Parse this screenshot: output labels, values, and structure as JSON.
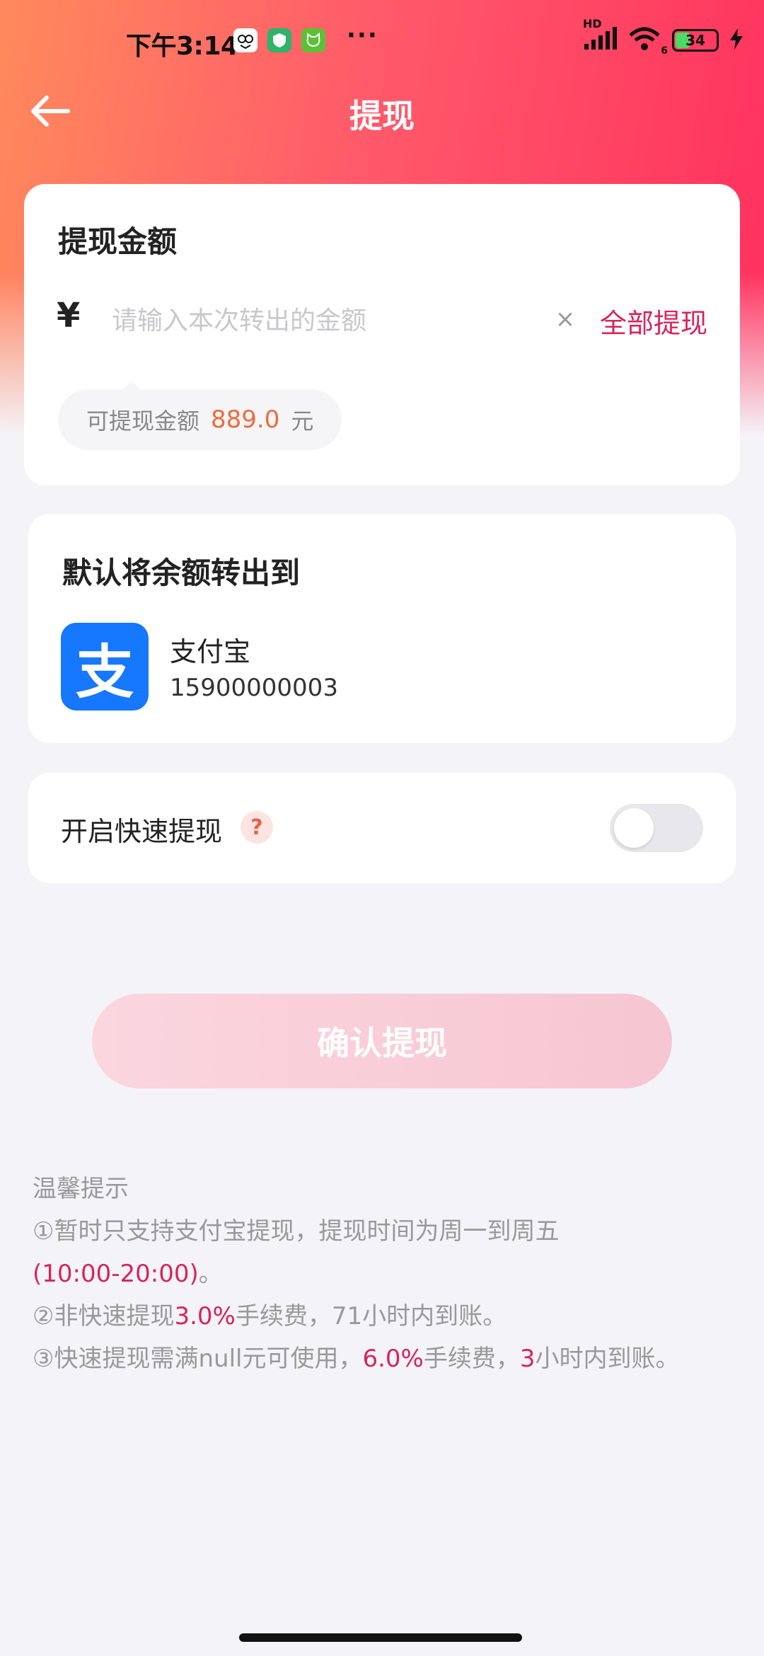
{
  "status_bar": {
    "time": "下午3:14",
    "more": "···",
    "network": "HD",
    "wifi_sub": "6",
    "battery": "34"
  },
  "header": {
    "title": "提现",
    "back_icon": "arrow-left-icon"
  },
  "amount_card": {
    "title": "提现金额",
    "currency": "¥",
    "input_placeholder": "请输入本次转出的金额",
    "input_value": "",
    "clear": "×",
    "withdraw_all": "全部提现",
    "balance_label": "可提现金额",
    "balance_value": "889.0",
    "balance_unit": "元"
  },
  "destination_card": {
    "title": "默认将余额转出到",
    "logo_glyph": "支",
    "method_name": "支付宝",
    "account": "15900000003"
  },
  "fast_card": {
    "label": "开启快速提现",
    "help": "?",
    "enabled": false
  },
  "confirm_button": "确认提现",
  "tips": {
    "title": "温馨提示",
    "line1": "①暂时只支持支付宝提现，提现时间为周一到周五",
    "line1_hours": "(10:00-20:00)",
    "line1_end": "。",
    "line2_a": "②非快速提现",
    "line2_rate": "3.0%",
    "line2_b": "手续费，71小时内到账。",
    "line3_a": "③快速提现需满null元可使用，",
    "line3_rate": "6.0%",
    "line3_b": "手续费，",
    "line3_hours": "3",
    "line3_c": "小时内到账。"
  },
  "colors": {
    "accent": "#d8245a",
    "balance": "#ef6a3a",
    "alipay": "#1677ff"
  }
}
